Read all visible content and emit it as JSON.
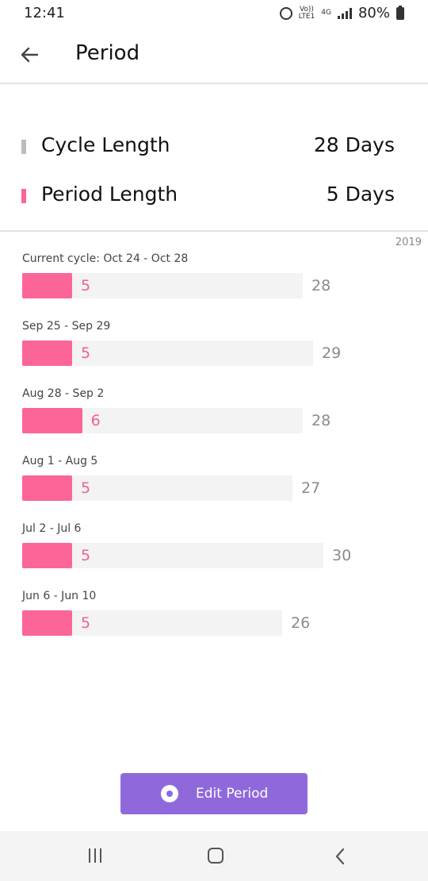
{
  "status_bar": {
    "time": "12:41",
    "network_top": "Vo))",
    "network_bottom": "LTE1",
    "net_type": "4G",
    "battery": "80%"
  },
  "app_bar": {
    "title": "Period",
    "back_icon": "arrow-left-icon"
  },
  "summary": {
    "cycle_length_label": "Cycle Length",
    "cycle_length_value": "28 Days",
    "cycle_marker_color": "#bdbdbd",
    "period_length_label": "Period Length",
    "period_length_value": "5 Days",
    "period_marker_color": "#fb6597"
  },
  "year_label": "2019",
  "cycles": [
    {
      "range": "Current cycle: Oct 24 - Oct 28",
      "period": 5,
      "cycle": 28,
      "period_text": "5",
      "cycle_text": "28"
    },
    {
      "range": "Sep 25 - Sep 29",
      "period": 5,
      "cycle": 29,
      "period_text": "5",
      "cycle_text": "29"
    },
    {
      "range": "Aug 28 - Sep 2",
      "period": 6,
      "cycle": 28,
      "period_text": "6",
      "cycle_text": "28"
    },
    {
      "range": "Aug 1 - Aug 5",
      "period": 5,
      "cycle": 27,
      "period_text": "5",
      "cycle_text": "27"
    },
    {
      "range": "Jul 2 - Jul 6",
      "period": 5,
      "cycle": 30,
      "period_text": "5",
      "cycle_text": "30"
    },
    {
      "range": "Jun 6 - Jun 10",
      "period": 5,
      "cycle": 26,
      "period_text": "5",
      "cycle_text": "26"
    }
  ],
  "edit_button": {
    "label": "Edit Period",
    "color": "#8f69dc"
  },
  "colors": {
    "period_fill": "#fb6597",
    "track": "#f3f3f3"
  }
}
